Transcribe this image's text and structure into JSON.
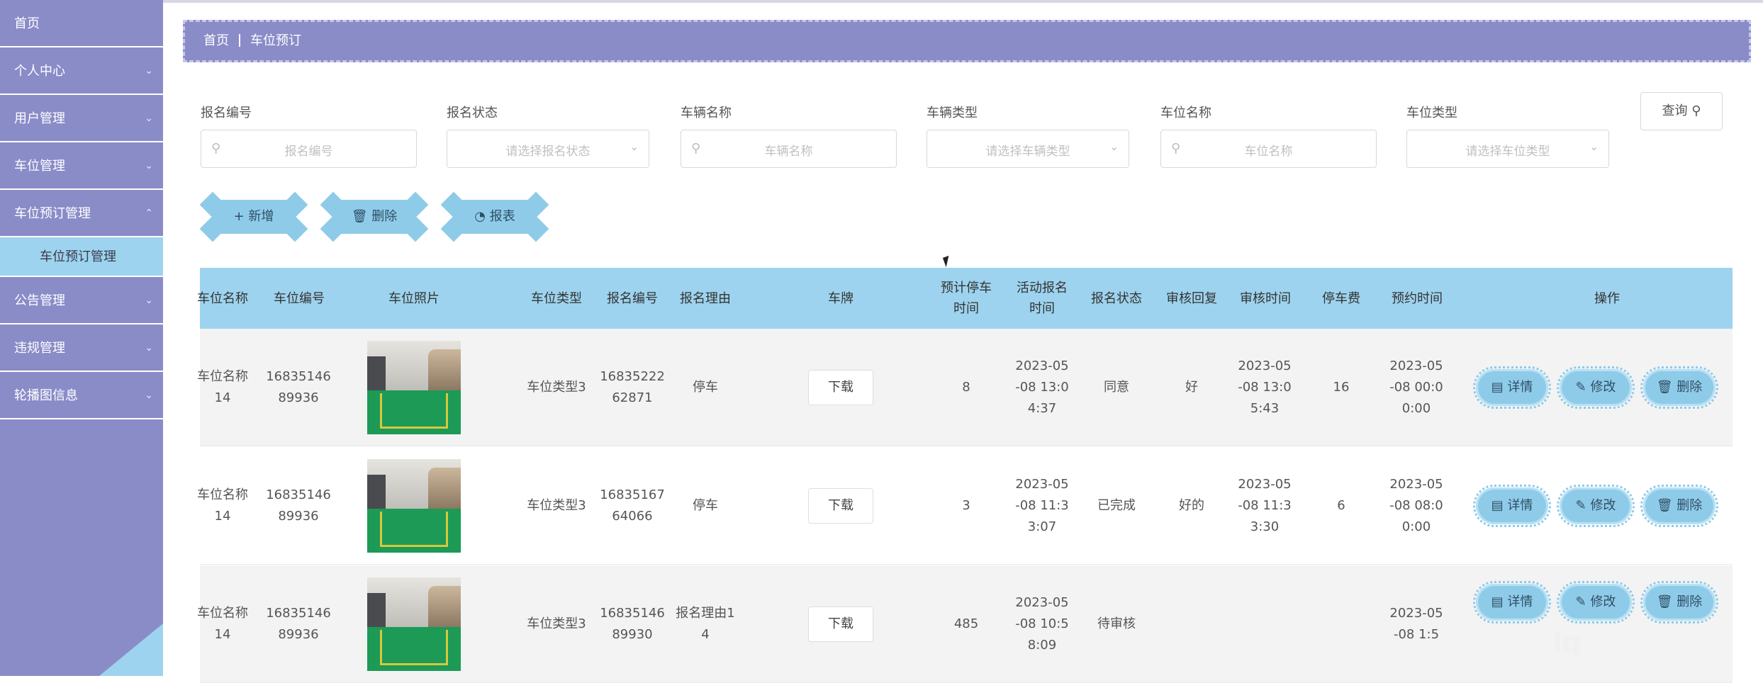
{
  "sidebar": {
    "items": [
      {
        "label": "首页",
        "chevron": false
      },
      {
        "label": "个人中心",
        "chevron": true
      },
      {
        "label": "用户管理",
        "chevron": true
      },
      {
        "label": "车位管理",
        "chevron": true
      },
      {
        "label": "车位预订管理",
        "chevron": true
      }
    ],
    "sub_item": "车位预订管理",
    "items_after": [
      {
        "label": "公告管理"
      },
      {
        "label": "违规管理"
      },
      {
        "label": "轮播图信息"
      }
    ]
  },
  "breadcrumb": {
    "home": "首页",
    "current": "车位预订"
  },
  "search": {
    "fields": [
      {
        "label": "报名编号",
        "placeholder": "报名编号",
        "type": "input"
      },
      {
        "label": "报名状态",
        "placeholder": "请选择报名状态",
        "type": "select"
      },
      {
        "label": "车辆名称",
        "placeholder": "车辆名称",
        "type": "input"
      },
      {
        "label": "车辆类型",
        "placeholder": "请选择车辆类型",
        "type": "select"
      },
      {
        "label": "车位名称",
        "placeholder": "车位名称",
        "type": "input"
      },
      {
        "label": "车位类型",
        "placeholder": "请选择车位类型",
        "type": "select"
      }
    ],
    "query_label": "查询"
  },
  "actions": {
    "add": "新增",
    "delete": "删除",
    "report": "报表"
  },
  "table": {
    "headers": [
      "车位名称",
      "车位编号",
      "车位照片",
      "车位类型",
      "报名编号",
      "报名理由",
      "车牌",
      "预计停车时间",
      "活动报名时间",
      "报名状态",
      "审核回复",
      "审核时间",
      "停车费",
      "预约时间",
      "操作"
    ],
    "rows": [
      {
        "name": "车位名称14",
        "code": "1683514689936",
        "type": "车位类型3",
        "reg_no": "1683522262871",
        "reason": "停车",
        "plate": "下载",
        "hours": "8",
        "reg_time": "2023-05-08 13:04:37",
        "status": "同意",
        "reply": "好",
        "audit_time": "2023-05-08 13:05:43",
        "fee": "16",
        "book_time": "2023-05-08 00:00:00"
      },
      {
        "name": "车位名称14",
        "code": "1683514689936",
        "type": "车位类型3",
        "reg_no": "1683516764066",
        "reason": "停车",
        "plate": "下载",
        "hours": "3",
        "reg_time": "2023-05-08 11:33:07",
        "status": "已完成",
        "reply": "好的",
        "audit_time": "2023-05-08 11:33:30",
        "fee": "6",
        "book_time": "2023-05-08 08:00:00"
      },
      {
        "name": "车位名称14",
        "code": "1683514689936",
        "type": "车位类型3",
        "reg_no": "1683514689930",
        "reason": "报名理由14",
        "plate": "下载",
        "hours": "485",
        "reg_time": "2023-05-08 10:58:09",
        "status": "待审核",
        "reply": "",
        "audit_time": "",
        "fee": "",
        "book_time": "2023-05-08 1:5"
      }
    ],
    "op_labels": {
      "detail": "详情",
      "edit": "修改",
      "delete": "删除"
    }
  },
  "watermark": "Iq"
}
